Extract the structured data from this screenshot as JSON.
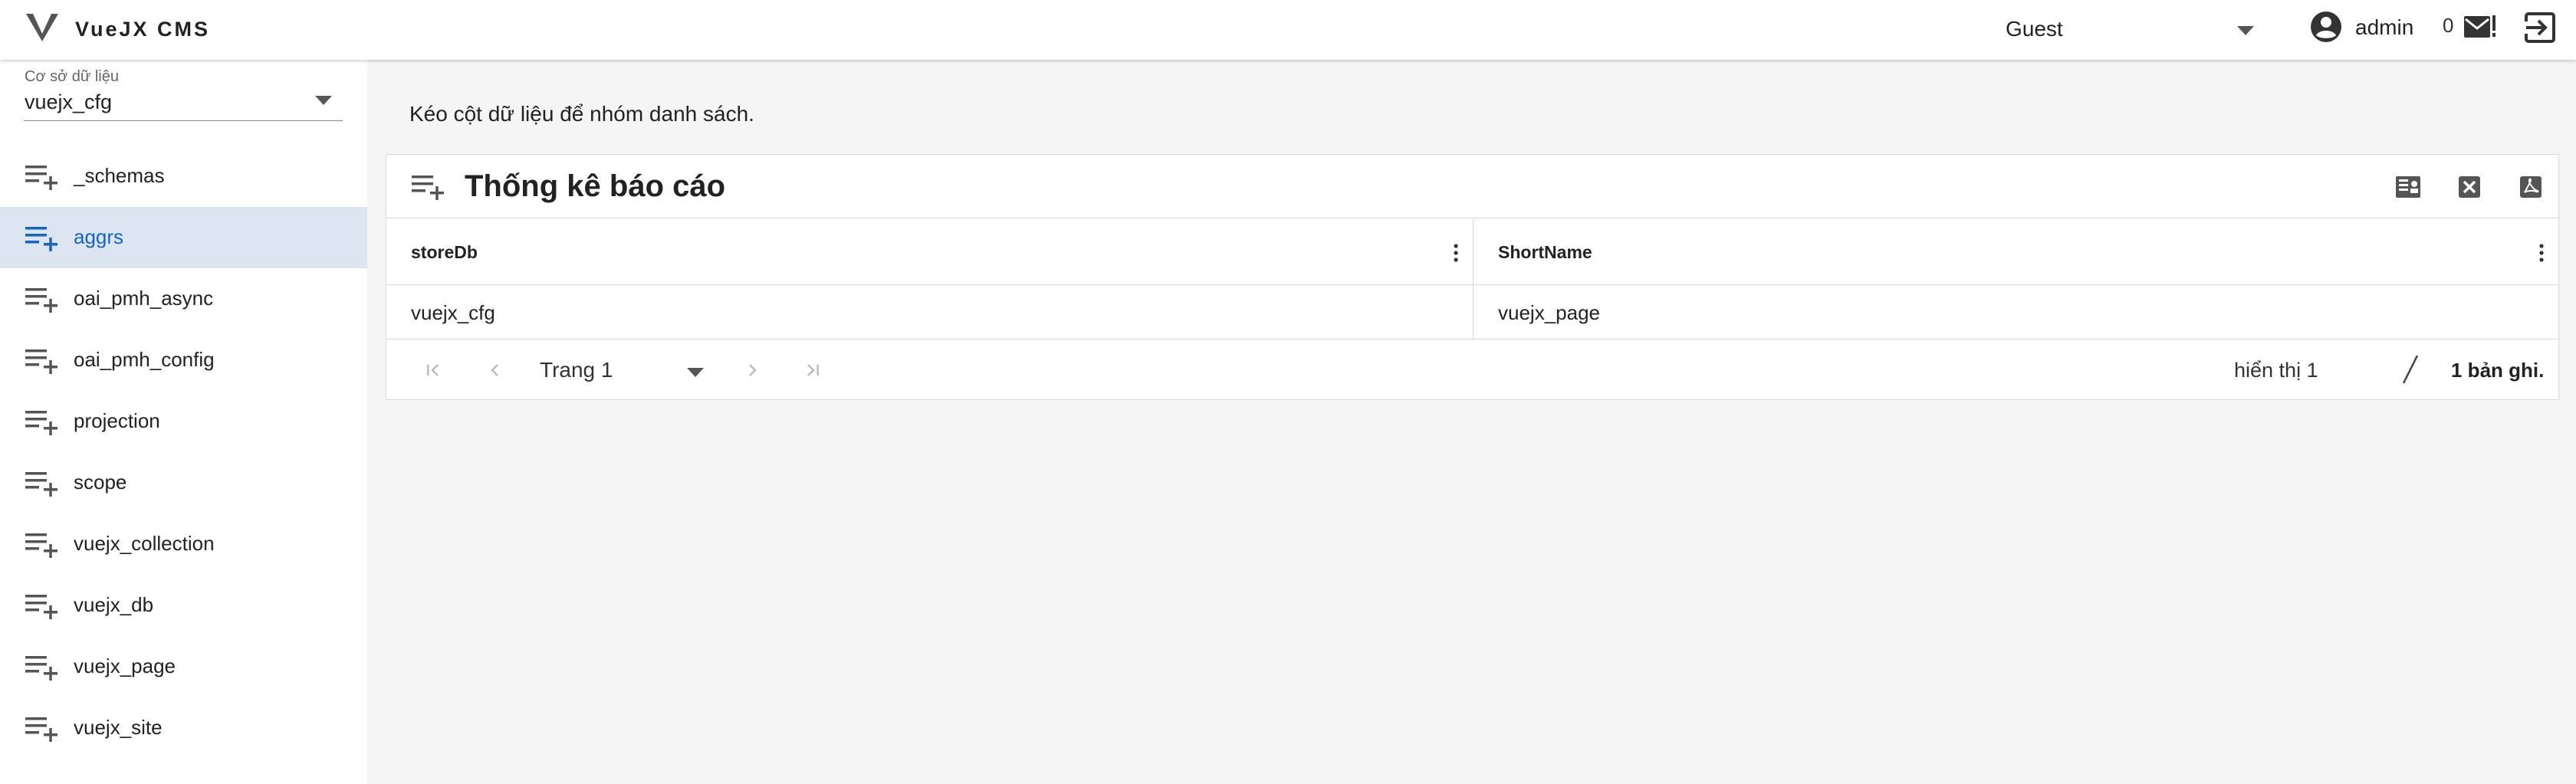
{
  "app": {
    "title": "VueJX CMS"
  },
  "header": {
    "role": "Guest",
    "user": "admin",
    "mail_count": "0",
    "icons": [
      "logo-icon",
      "chevron-down-icon",
      "account-circle-icon",
      "mail-alert-icon",
      "logout-icon"
    ]
  },
  "sidebar": {
    "db_label": "Cơ sở dữ liệu",
    "db_value": "vuejx_cfg",
    "items": [
      {
        "label": "_schemas"
      },
      {
        "label": "aggrs",
        "active": true
      },
      {
        "label": "oai_pmh_async"
      },
      {
        "label": "oai_pmh_config"
      },
      {
        "label": "projection"
      },
      {
        "label": "scope"
      },
      {
        "label": "vuejx_collection"
      },
      {
        "label": "vuejx_db"
      },
      {
        "label": "vuejx_page"
      },
      {
        "label": "vuejx_site"
      }
    ]
  },
  "main": {
    "group_hint": "Kéo cột dữ liệu để nhóm danh sách.",
    "title": "Thống kê báo cáo",
    "tools": [
      "print-icon",
      "excel-icon",
      "pdf-icon"
    ],
    "table": {
      "columns": [
        "storeDb",
        "ShortName"
      ],
      "rows": [
        [
          "vuejx_cfg",
          "vuejx_page"
        ]
      ]
    },
    "pager": {
      "page": "Trang 1",
      "showing": "hiển thị 1",
      "total": "1 bản ghi."
    }
  },
  "colors": {
    "accent": "#1565c0",
    "active_bg": "#dde6f0",
    "icon": "#555555"
  }
}
